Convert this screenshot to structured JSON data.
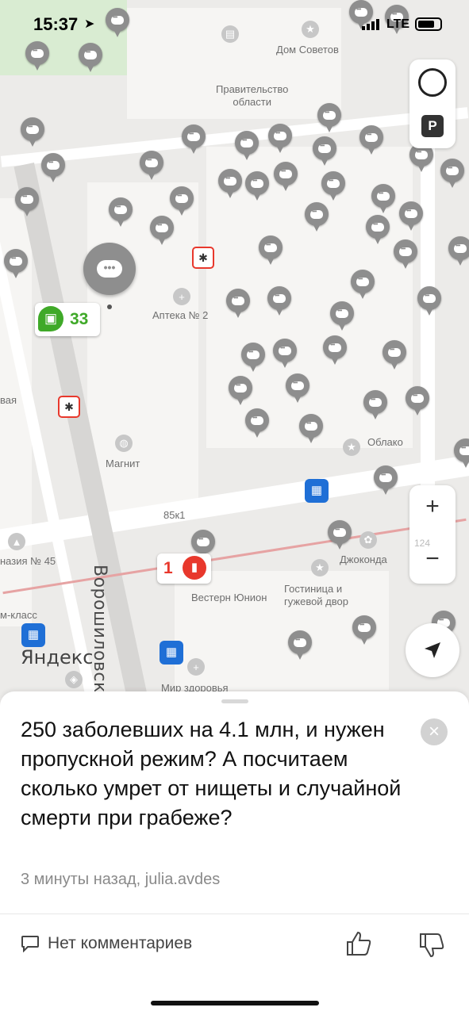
{
  "status_bar": {
    "time": "15:37",
    "network": "LTE"
  },
  "map": {
    "labels": {
      "dom_sovetov": "Дом Советов",
      "government": "Правительство\nобласти",
      "apteka": "Аптека № 2",
      "magnit": "Магнит",
      "oblako": "Облако",
      "building_85": "85к1",
      "dzhokonda": "Джоконда",
      "western_union": "Вестерн Юнион",
      "hotel": "Гостиница и\nгужевой двор",
      "school": "назия № 45",
      "street_voroshilovsky": "Ворошиловск",
      "class_label": "м-класс",
      "mir_zdorovya": "Мир здоровья",
      "vaya": "вая",
      "yandex": "Яндекс",
      "scale_124": "124"
    },
    "bus_badge": "33",
    "tram_badge": "1",
    "zoom_in": "+",
    "zoom_out": "−",
    "parking": "P"
  },
  "sheet": {
    "post_text": "250 заболевших на 4.1 млн, и нужен пропускной режим? А посчитаем сколько умрет от нищеты и случайной смерти при грабеже?",
    "meta": "3 минуты назад, julia.avdes",
    "comments_label": "Нет комментариев",
    "close": "×"
  },
  "colors": {
    "bus_green": "#3fa928",
    "tram_red": "#e8382c",
    "transit_blue": "#1f6fd6",
    "pin_gray": "#8e8e8e"
  },
  "icons": [
    "location-arrow-icon",
    "traffic-icon",
    "parking-icon",
    "thumb-up-icon",
    "thumb-down-icon",
    "comment-icon",
    "close-icon"
  ]
}
